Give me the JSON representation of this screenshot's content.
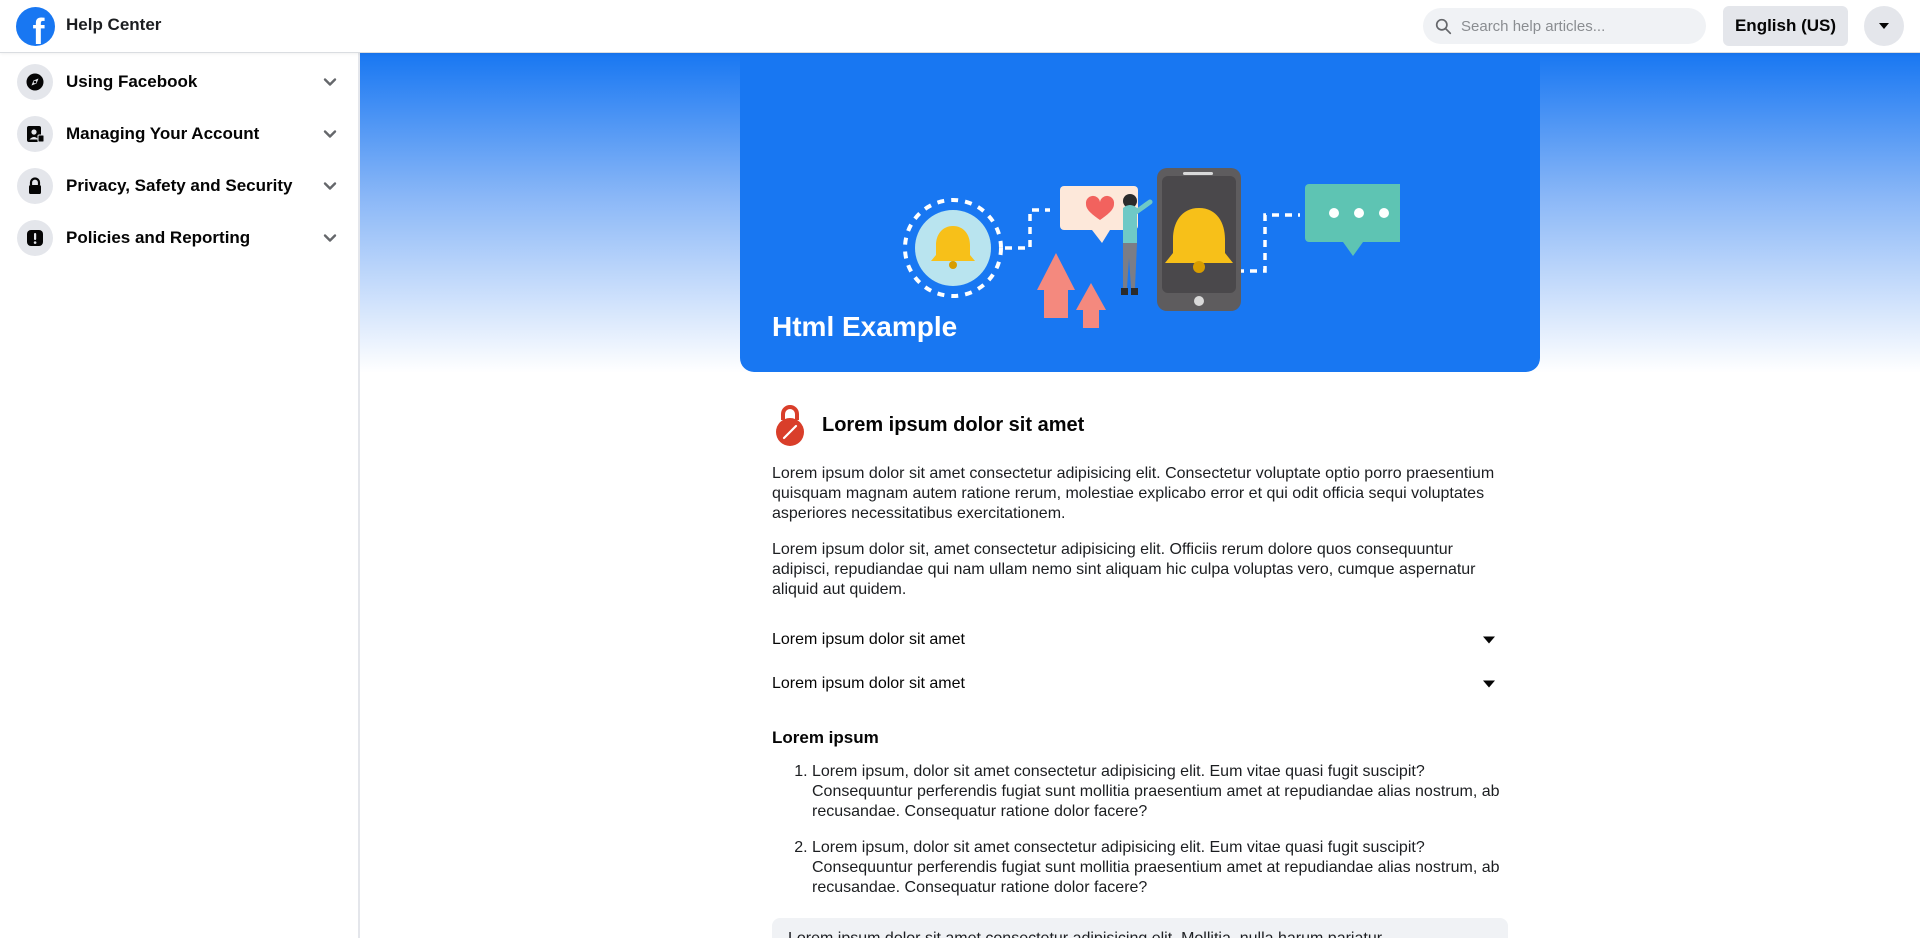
{
  "header": {
    "brand": "Help Center",
    "search_placeholder": "Search help articles...",
    "language": "English (US)"
  },
  "sidebar": {
    "items": [
      {
        "label": "Using Facebook",
        "icon": "compass-icon"
      },
      {
        "label": "Managing Your Account",
        "icon": "user-card-icon"
      },
      {
        "label": "Privacy, Safety and Security",
        "icon": "lock-icon"
      },
      {
        "label": "Policies and Reporting",
        "icon": "alert-icon"
      }
    ]
  },
  "hero": {
    "title": "Html Example"
  },
  "article": {
    "section_title": "Lorem ipsum dolor sit amet",
    "paragraphs": [
      "Lorem ipsum dolor sit amet consectetur adipisicing elit. Consectetur voluptate optio porro praesentium quisquam magnam autem ratione rerum, molestiae explicabo error et qui odit officia sequi voluptates asperiores necessitatibus exercitationem.",
      "Lorem ipsum dolor sit, amet consectetur adipisicing elit. Officiis rerum dolore quos consequuntur adipisci, repudiandae qui nam ullam nemo sint aliquam hic culpa voluptas vero, cumque aspernatur aliquid aut quidem."
    ],
    "accordions": [
      "Lorem ipsum dolor sit amet",
      "Lorem ipsum dolor sit amet"
    ],
    "subheading": "Lorem ipsum",
    "list": [
      "Lorem ipsum, dolor sit amet consectetur adipisicing elit. Eum vitae quasi fugit suscipit? Consequuntur perferendis fugiat sunt mollitia praesentium amet at repudiandae alias nostrum, ab recusandae. Consequatur ratione dolor facere?",
      "Lorem ipsum, dolor sit amet consectetur adipisicing elit. Eum vitae quasi fugit suscipit? Consequuntur perferendis fugiat sunt mollitia praesentium amet at repudiandae alias nostrum, ab recusandae. Consequatur ratione dolor facere?"
    ],
    "note": "Lorem ipsum dolor sit amet consectetur adipisicing elit. Mollitia, nulla harum pariatur"
  },
  "colors": {
    "brand_blue": "#1877f2",
    "chip_grey": "#e4e6eb",
    "warning_red": "#d93e2a"
  }
}
